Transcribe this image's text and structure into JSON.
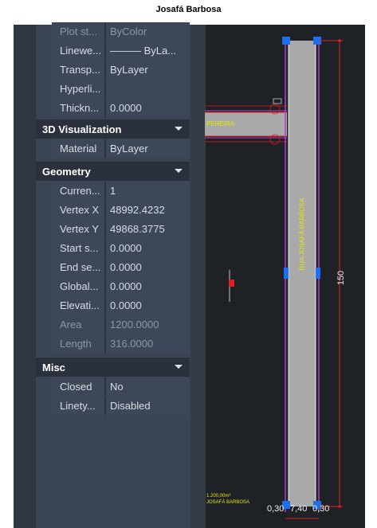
{
  "page_title": "Josafá Barbosa",
  "properties": {
    "general_rows": [
      {
        "name": "Plot st...",
        "value": "ByColor",
        "dim": true
      },
      {
        "name": "Linewe...",
        "value": "——— ByLa...",
        "dim": false
      },
      {
        "name": "Transp...",
        "value": "ByLayer",
        "dim": false
      },
      {
        "name": "Hyperli...",
        "value": "",
        "dim": false
      },
      {
        "name": "Thickn...",
        "value": "0.0000",
        "dim": false
      }
    ],
    "viz_section": {
      "title": "3D Visualization"
    },
    "viz_rows": [
      {
        "name": "Material",
        "value": "ByLayer",
        "dim": false
      }
    ],
    "geometry_section": {
      "title": "Geometry"
    },
    "geometry_rows": [
      {
        "name": "Curren...",
        "value": "1",
        "dim": false
      },
      {
        "name": "Vertex X",
        "value": "48992.4232",
        "dim": false
      },
      {
        "name": "Vertex Y",
        "value": "49868.3775",
        "dim": false
      },
      {
        "name": "Start s...",
        "value": "0.0000",
        "dim": false
      },
      {
        "name": "End se...",
        "value": "0.0000",
        "dim": false
      },
      {
        "name": "Global...",
        "value": "0.0000",
        "dim": false
      },
      {
        "name": "Elevati...",
        "value": "0.0000",
        "dim": false
      },
      {
        "name": "Area",
        "value": "1200.0000",
        "dim": true
      },
      {
        "name": "Length",
        "value": "316.0000",
        "dim": true
      }
    ],
    "misc_section": {
      "title": "Misc"
    },
    "misc_rows": [
      {
        "name": "Closed",
        "value": "No",
        "dim": false
      },
      {
        "name": "Linety...",
        "value": "Disabled",
        "dim": false
      }
    ]
  },
  "drawing": {
    "street_label_vertical": "RUA JOSAFÁ BARBOSA",
    "street_label_cross": "PEREIRA",
    "dimension_height": "150",
    "dimension_bottom": [
      "0,30",
      "7,40",
      "0,30"
    ],
    "area_note_line1": "1.200,00m²",
    "area_note_line2": "JOSAFÁ BARBOSA",
    "colors": {
      "road_fill": "#a9a9a9",
      "outline": "#b040c8",
      "dimension": "#e02020",
      "label": "#e6e600",
      "grip": "#1e6ff0"
    }
  }
}
